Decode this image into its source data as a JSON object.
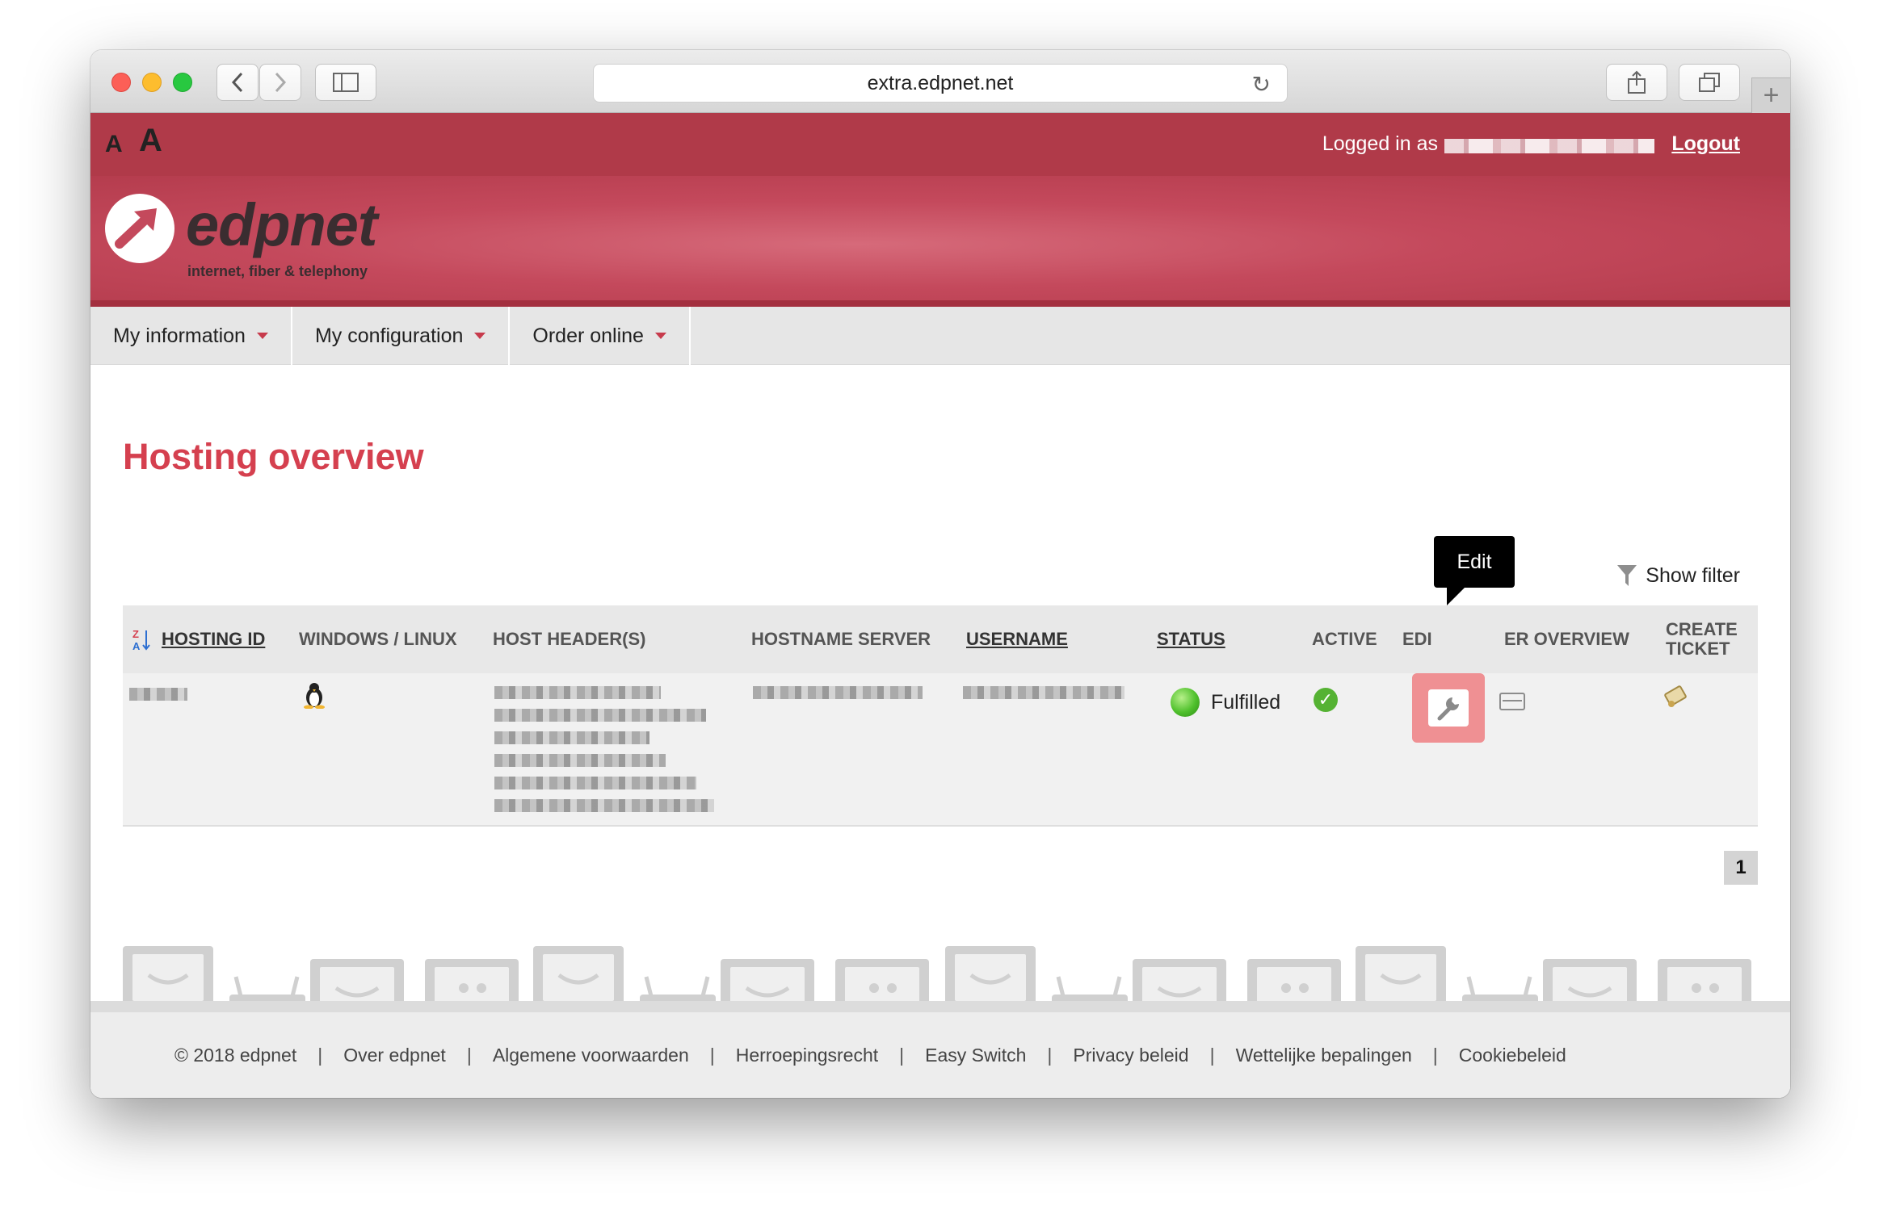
{
  "browser": {
    "url": "extra.edpnet.net"
  },
  "topbar": {
    "font_small": "A",
    "font_large": "A",
    "logged_in_label": "Logged in as",
    "logout": "Logout"
  },
  "brand": {
    "name_dark": "edp",
    "name_light": "net",
    "tagline": "internet, fiber & telephony"
  },
  "nav": {
    "items": [
      {
        "label": "My information"
      },
      {
        "label": "My configuration"
      },
      {
        "label": "Order online"
      }
    ]
  },
  "page": {
    "title": "Hosting overview",
    "show_filter": "Show filter"
  },
  "table": {
    "headers": {
      "hosting_id": "HOSTING ID",
      "windows_linux": "WINDOWS / LINUX",
      "host_headers": "HOST HEADER(S)",
      "hostname_server": "HOSTNAME SERVER",
      "username": "USERNAME",
      "status": "STATUS",
      "active": "ACTIVE",
      "edit_partial": "EDI",
      "overview_partial": "ER OVERVIEW",
      "create_ticket_line1": "CREATE",
      "create_ticket_line2": "TICKET"
    },
    "row": {
      "status": "Fulfilled"
    }
  },
  "tooltip": {
    "edit": "Edit"
  },
  "pagination": {
    "current": "1"
  },
  "footer": {
    "links": [
      "© 2018 edpnet",
      "Over edpnet",
      "Algemene voorwaarden",
      "Herroepingsrecht",
      "Easy Switch",
      "Privacy beleid",
      "Wettelijke bepalingen",
      "Cookiebeleid"
    ]
  },
  "colors": {
    "brand_red": "#b03a49",
    "title_red": "#d5404f",
    "edit_highlight": "#ef9093",
    "status_green": "#4fc02c"
  }
}
